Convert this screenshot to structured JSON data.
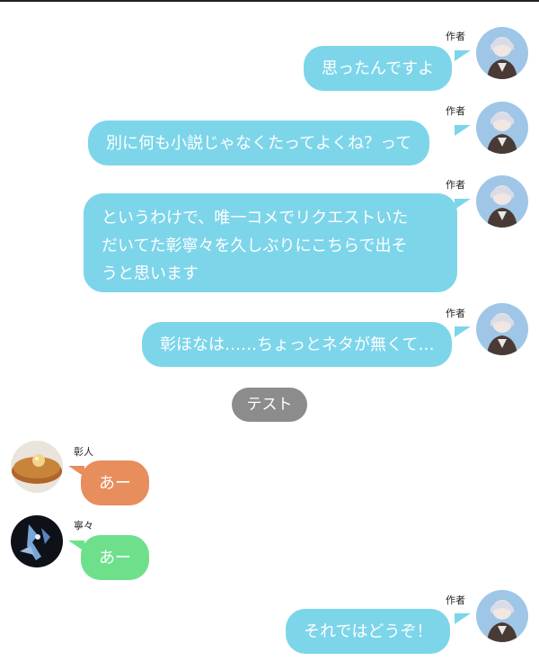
{
  "messages": [
    {
      "speaker": "作者",
      "text": "思ったんですよ"
    },
    {
      "speaker": "作者",
      "text": "別に何も小説じゃなくたってよくね？って"
    },
    {
      "speaker": "作者",
      "text_lines": [
        "というわけで、唯一コメでリクエストいた",
        "だいてた彰寧々を久しぶりにこちらで出そ",
        "うと思います"
      ]
    },
    {
      "speaker": "作者",
      "text": "彰ほなは……ちょっとネタが無くて…"
    },
    {
      "system": "テスト"
    },
    {
      "speaker": "彰人",
      "text": "あー"
    },
    {
      "speaker": "寧々",
      "text": "あー"
    },
    {
      "speaker": "作者",
      "text": "それではどうぞ！"
    }
  ],
  "colors": {
    "author_bubble": "#7dd5ea",
    "akito_bubble": "#e88d5c",
    "nene_bubble": "#6ee08c",
    "system_pill": "#8c8c8c"
  },
  "avatars": {
    "author": "anime-character-avatar",
    "akito": "pancake-food-avatar",
    "nene": "robot-mech-avatar"
  }
}
